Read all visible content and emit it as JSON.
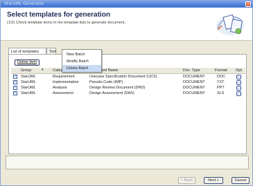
{
  "window": {
    "title": "StarUML Generator",
    "close_icon": "close-icon"
  },
  "header": {
    "title": "Select templates for generation",
    "subtitle": "(1/3) Check template items in the template lists to generate document."
  },
  "tabs": [
    {
      "label": "List of templates"
    },
    {
      "label": "Text"
    }
  ],
  "toolbar": {
    "delete_label": "Delete Item"
  },
  "context_menu": {
    "items": [
      {
        "label": "New Batch"
      },
      {
        "label": "Modify Batch"
      },
      {
        "label": "Delete Batch"
      }
    ]
  },
  "grid": {
    "columns": [
      "Group",
      "Category",
      "Document Name",
      "Doc. Type",
      "Format",
      "Opt"
    ],
    "rows": [
      {
        "group": "StarUML",
        "category": "Requirement",
        "name": "Usecase Specification Document (UCS)",
        "doctype": "DOCUMENT",
        "format": "DOC",
        "checked": "✓"
      },
      {
        "group": "StarUML",
        "category": "Implementation",
        "name": "Pseudo Code (IMP)",
        "doctype": "DOCUMENT",
        "format": "TXT",
        "checked": "✓"
      },
      {
        "group": "StarUML",
        "category": "Analysis",
        "name": "Design Review Document (DRD)",
        "doctype": "DOCUMENT",
        "format": "PPT",
        "checked": "✓"
      },
      {
        "group": "StarUML",
        "category": "Assessment",
        "name": "Design Assessment (DAS)",
        "doctype": "DOCUMENT",
        "format": "XLS",
        "checked": "✓"
      }
    ]
  },
  "buttons": {
    "back": "< Back",
    "next": "Next >",
    "cancel": "Cancel"
  },
  "colors": {
    "titlebar": "#4c7fd6",
    "header_title": "#1e2a55",
    "menu_highlight": "#c9daf5"
  }
}
